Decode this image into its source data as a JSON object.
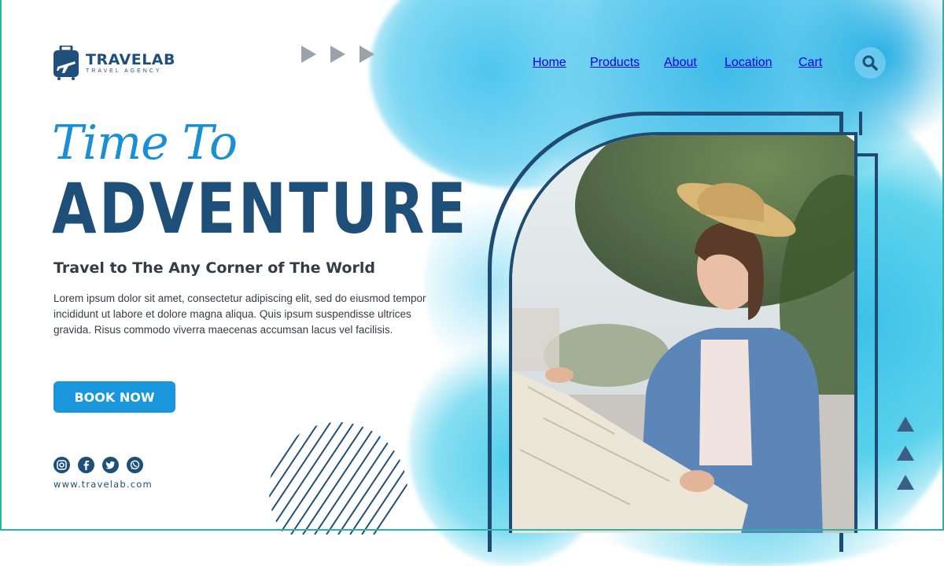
{
  "brand": {
    "name": "TRAVELAB",
    "tagline": "TRAVEL AGENCY",
    "logo_icon": "suitcase-plane-icon"
  },
  "nav": {
    "items": [
      {
        "label": "Home"
      },
      {
        "label": "Products"
      },
      {
        "label": "About"
      },
      {
        "label": "Location"
      },
      {
        "label": "Cart"
      }
    ],
    "search_icon": "search-icon"
  },
  "hero": {
    "script_title": "Time To",
    "title": "ADVENTURE",
    "subtitle": "Travel to The Any Corner of The World",
    "body": "Lorem ipsum dolor sit amet, consectetur adipiscing elit, sed do eiusmod tempor incididunt ut labore et dolore magna aliqua. Quis ipsum suspendisse ultrices gravida. Risus commodo viverra maecenas accumsan lacus vel facilisis.",
    "cta_label": "BOOK NOW"
  },
  "footer": {
    "socials": [
      "instagram-icon",
      "facebook-icon",
      "twitter-icon",
      "whatsapp-icon"
    ],
    "website": "www.travelab.com"
  },
  "colors": {
    "accent": "#1a96dc",
    "navy": "#1e4f79",
    "watercolor": "#3fbbe9"
  }
}
